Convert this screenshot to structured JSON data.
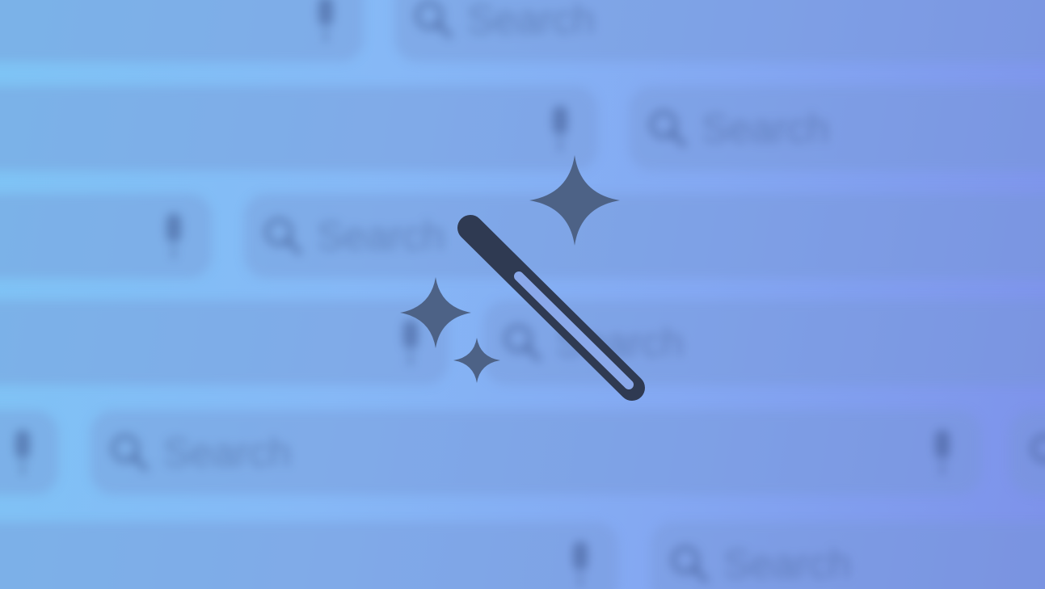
{
  "search_bars": [
    {
      "placeholder": "Search"
    },
    {
      "placeholder": "Search"
    },
    {
      "placeholder": "Search"
    },
    {
      "placeholder": "Search"
    },
    {
      "placeholder": "Search"
    },
    {
      "placeholder": "Search"
    }
  ],
  "icons": {
    "search": "magnifying-glass",
    "mic": "microphone",
    "center": "magic-wand-with-sparkles"
  },
  "colors": {
    "background_start": "#7ec4f5",
    "background_end": "#7d92ea",
    "wand": "#2f3a52",
    "sparkle": "#4d6286"
  }
}
